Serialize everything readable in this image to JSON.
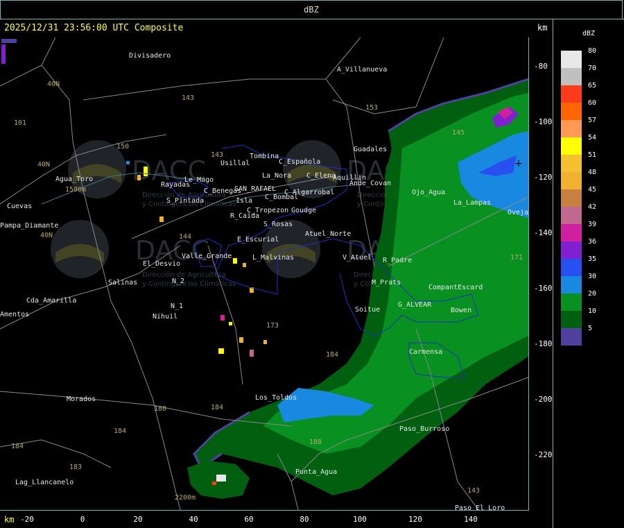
{
  "header": {
    "product_title": "dBZ",
    "timestamp": "2025/12/31 23:56:00 UTC Composite",
    "unit_top": "km",
    "unit_bottom": "km"
  },
  "legend": {
    "title": "dBZ",
    "items": [
      {
        "label": "80",
        "color": "#e8e8e8"
      },
      {
        "label": "70",
        "color": "#c0c0c0"
      },
      {
        "label": "65",
        "color": "#ff3a1a"
      },
      {
        "label": "60",
        "color": "#ff6600"
      },
      {
        "label": "57",
        "color": "#ff9955"
      },
      {
        "label": "54",
        "color": "#ffff00"
      },
      {
        "label": "51",
        "color": "#f5c030"
      },
      {
        "label": "48",
        "color": "#f0b030"
      },
      {
        "label": "45",
        "color": "#c88040"
      },
      {
        "label": "42",
        "color": "#c06890"
      },
      {
        "label": "39",
        "color": "#d020a0"
      },
      {
        "label": "36",
        "color": "#8020d0"
      },
      {
        "label": "35",
        "color": "#2850f0"
      },
      {
        "label": "30",
        "color": "#1888e0"
      },
      {
        "label": "20",
        "color": "#089020"
      },
      {
        "label": "10",
        "color": "#006010"
      },
      {
        "label": "5",
        "color": "#5040a0"
      }
    ]
  },
  "axes": {
    "y_ticks": [
      "-80",
      "-100",
      "-120",
      "-140",
      "-160",
      "-180",
      "-200",
      "-220"
    ],
    "x_ticks": [
      "-20",
      "0",
      "20",
      "40",
      "60",
      "80",
      "100",
      "120",
      "140"
    ]
  },
  "map": {
    "watermark_text": "DACC",
    "watermark_sub_1": "Dirección de Agricultura",
    "watermark_sub_2": "y Contingencias Climáticas",
    "places": [
      "Divisadero",
      "A_Villanueva",
      "Guadales",
      "Usillal",
      "Tombina",
      "C_Española",
      "La_Nora",
      "C_Elena",
      "Aquillin",
      "Ande_Covan",
      "Agua_Toro",
      "Rayadas",
      "S_Pintada",
      "Le_Mago",
      "C_Benegas",
      "SAN_RAFAEL",
      "C_Bombal",
      "C_Algarrobal",
      "Isla",
      "R_Caida",
      "C_Tropezon",
      "Goudge",
      "S_Rosas",
      "Atuel_Norte",
      "E_Escurial",
      "Pampa_Diamante",
      "Valle_Grande",
      "L_Malvinas",
      "V_Atuel",
      "R_Padre",
      "El_Desvio",
      "Salinas",
      "M_Prats",
      "CompantEscard",
      "N_2",
      "Soitue",
      "G_ALVEAR",
      "Bowen",
      "Cda_Amarilla",
      "N_1",
      "Nihuil",
      "Amentos",
      "Carmensa",
      "Los_Toldos",
      "Morados",
      "Paso_Burroso",
      "Punta_Agua",
      "Lag_Llancanelo",
      "Paso_El_Loro",
      "Ojo_Agua",
      "Ovejas",
      "La_Lampas",
      "Cuevas"
    ],
    "road_numbers": [
      "143",
      "153",
      "101",
      "40N",
      "40N",
      "40N",
      "150",
      "143",
      "144",
      "173",
      "180",
      "184",
      "184",
      "184",
      "184",
      "183",
      "143",
      "145",
      "188",
      "171"
    ],
    "elevations": [
      "1500m",
      "2200m"
    ]
  }
}
